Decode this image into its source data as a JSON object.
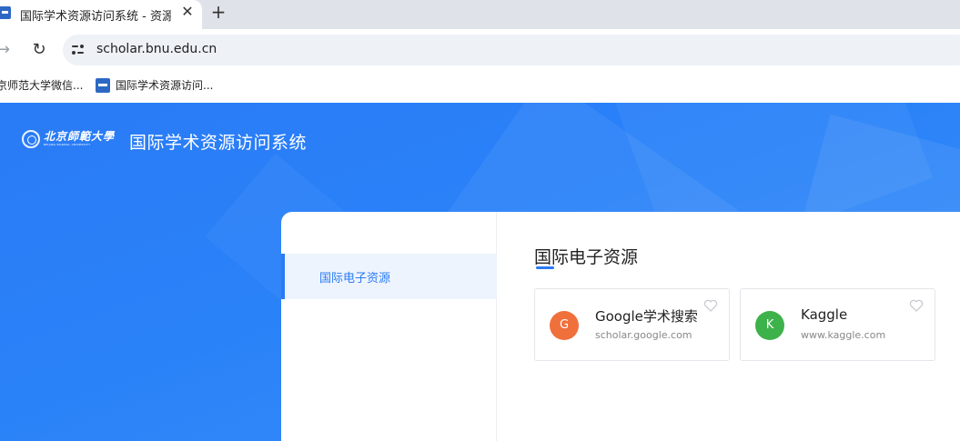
{
  "browser": {
    "tab_title": "国际学术资源访问系统 - 资源站",
    "close_glyph": "✕",
    "new_tab_glyph": "+",
    "forward_glyph": "→",
    "reload_glyph": "↻",
    "url": "scholar.bnu.edu.cn",
    "bookmarks": [
      {
        "label": "京师范大学微信..."
      },
      {
        "label": "国际学术资源访问..."
      }
    ]
  },
  "header": {
    "logo_cn": "北京師範大學",
    "logo_en": "BEIJING NORMAL UNIVERSITY",
    "site_title": "国际学术资源访问系统"
  },
  "sidebar": {
    "items": [
      {
        "label": "国际电子资源",
        "active": true
      }
    ]
  },
  "main": {
    "section_title": "国际电子资源",
    "cards": [
      {
        "initial": "G",
        "name": "Google学术搜索",
        "url": "scholar.google.com",
        "color": "#f0703c"
      },
      {
        "initial": "K",
        "name": "Kaggle",
        "url": "www.kaggle.com",
        "color": "#3db24a"
      }
    ]
  },
  "colors": {
    "brand": "#2a7bf6",
    "header_bg": "#2a82f8"
  }
}
